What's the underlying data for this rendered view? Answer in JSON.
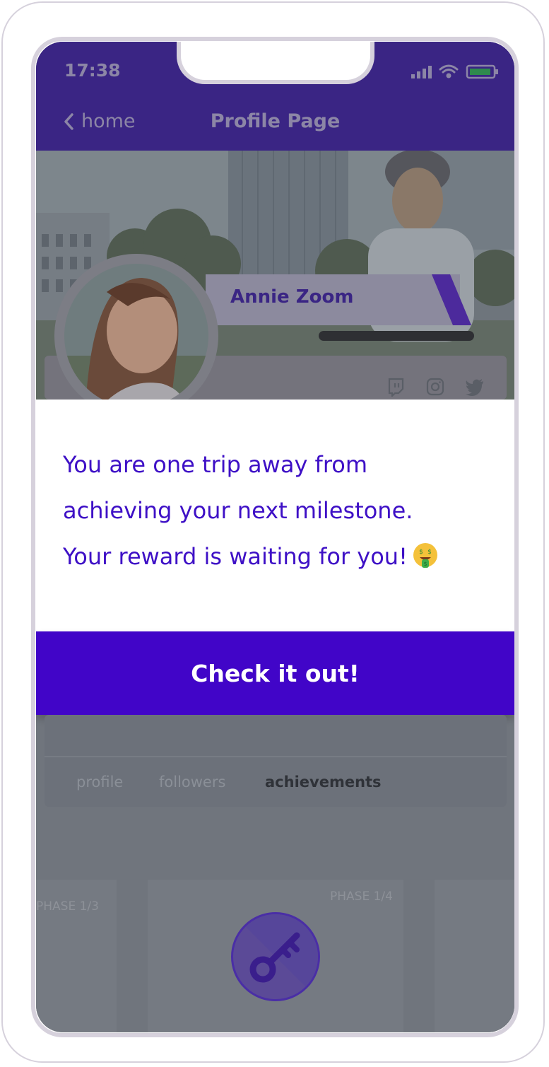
{
  "status_bar": {
    "time": "17:38"
  },
  "nav": {
    "back_label": "home",
    "title": "Profile Page"
  },
  "profile": {
    "name": "Annie Zoom"
  },
  "social": [
    "twitch-icon",
    "instagram-icon",
    "twitter-icon"
  ],
  "popup": {
    "lines": [
      "You are one trip away from",
      "achieving your next milestone.",
      "Your reward is waiting for you!"
    ],
    "emoji": "money-mouth-face-icon",
    "cta_label": "Check it out!"
  },
  "tabs": [
    {
      "label": "profile",
      "active": false
    },
    {
      "label": "followers",
      "active": false
    },
    {
      "label": "achievements",
      "active": true
    }
  ],
  "achievements": {
    "left_phase": "PHASE 1/3",
    "center_phase": "PHASE 1/4",
    "badge_icon": "key-icon"
  },
  "colors": {
    "header": "#3a2584",
    "accent": "#4105c8",
    "text_accent": "#3e10c6"
  }
}
